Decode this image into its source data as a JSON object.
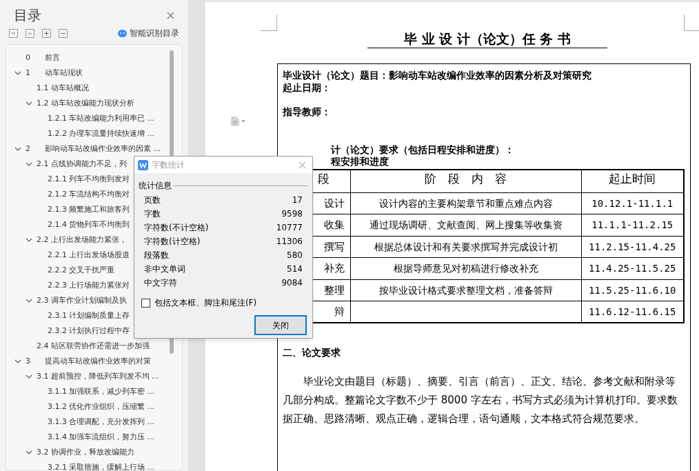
{
  "toc_panel": {
    "title": "目录",
    "smart_button": "智能识别目录",
    "items": [
      {
        "num": "0",
        "title": "前言"
      },
      {
        "num": "1",
        "title": "动车站现状",
        "expanded": true,
        "children": [
          {
            "num": "1.1",
            "title": "动车站概况"
          },
          {
            "num": "1.2",
            "title": "动车站改编能力现状分析",
            "expanded": true,
            "children": [
              {
                "num": "1.2.1",
                "title": "车站改编能力利用率已 ..."
              },
              {
                "num": "1.2.2",
                "title": "办理车流量持续快速增 ..."
              }
            ]
          }
        ]
      },
      {
        "num": "2",
        "title": "影响动车站改编作业效率的因素 ...",
        "expanded": true,
        "children": [
          {
            "num": "2.1",
            "title": "点线协调能力不足，列",
            "expanded": true,
            "children": [
              {
                "num": "2.1.1",
                "title": "列车不均衡到发对"
              },
              {
                "num": "2.1.2",
                "title": "车流结构不均衡对"
              },
              {
                "num": "2.1.3",
                "title": "频繁施工和旅客列"
              },
              {
                "num": "2.1.4",
                "title": "货物列车不均衡到"
              }
            ]
          },
          {
            "num": "2.2",
            "title": "上行出发场能力紧张，",
            "expanded": true,
            "children": [
              {
                "num": "2.2.1",
                "title": "上行出发场场股道"
              },
              {
                "num": "2.2.2",
                "title": "交叉干扰严重"
              },
              {
                "num": "2.2.3",
                "title": "上行场能力紧张对"
              }
            ]
          },
          {
            "num": "2.3",
            "title": "调车作业计划编制及执",
            "expanded": true,
            "children": [
              {
                "num": "2.3.1",
                "title": "计划编制质量上存"
              },
              {
                "num": "2.3.2",
                "title": "计划执行过程中存"
              }
            ]
          },
          {
            "num": "2.4",
            "title": "站区联劳协作还需进一步加强"
          }
        ]
      },
      {
        "num": "3",
        "title": "提高动车站改编作业效率的对策",
        "expanded": true,
        "children": [
          {
            "num": "3.1",
            "title": "超前预控，降低列车到发不均 ...",
            "expanded": true,
            "children": [
              {
                "num": "3.1.1",
                "title": "加强联系，减少列车密 ..."
              },
              {
                "num": "3.1.2",
                "title": "优化作业组织，压缩繁 ..."
              },
              {
                "num": "3.1.3",
                "title": "合理调配，充分发挥列 ..."
              },
              {
                "num": "3.1.4",
                "title": "加强车流组织，努力压 ..."
              }
            ]
          },
          {
            "num": "3.2",
            "title": "协调作业，释放改编能力",
            "expanded": true,
            "children": [
              {
                "num": "3.2.1",
                "title": "采取措施，缓解上行场 ..."
              }
            ]
          }
        ]
      }
    ]
  },
  "document": {
    "heading": "毕 业 设 计（论文）任 务 书",
    "lines": [
      "毕业设计（论文）题目：影响动车站改编作业效率的因素分析及对策研究",
      "起止日期：",
      "指导教师：",
      "计（论文）要求（包括日程安排和进度）：",
      "程安排和进度"
    ],
    "table": {
      "columns": [
        "段",
        "阶　段　内　容",
        "起止时间"
      ],
      "rows": [
        [
          "设计",
          "设计内容的主要构架章节和重点难点内容",
          "10.12.1-11.1.1"
        ],
        [
          "收集",
          "通过现场调研、文献查阅、网上搜集等收集资",
          "11.1.1-11.2.15"
        ],
        [
          "撰写",
          "根据总体设计和有关要求撰写并完成设计初",
          "11.2.15-11.4.25"
        ],
        [
          "补充",
          "根据导师意见对初稿进行修改补充",
          "11.4.25-11.5.25"
        ],
        [
          "整理",
          "按毕业设计格式要求整理文档，准备答辩",
          "11.5.25-11.6.10"
        ],
        [
          "辩",
          "",
          "11.6.12-11.6.15"
        ]
      ]
    },
    "section_heading": "二、论文要求",
    "paragraph": "毕业论文由题目（标题）、摘要、引言（前言）、正文、结论、参考文献和附录等几部分构成。整篇论文字数不少于 8000 字左右，书写方式必须为计算机打印。要求数据正确、思路清晰、观点正确，逻辑合理，语句通顺，文本格式符合规范要求。"
  },
  "dialog": {
    "title": "字数统计",
    "group": "统计信息",
    "stats": [
      {
        "label": "页数",
        "value": "17"
      },
      {
        "label": "字数",
        "value": "9598"
      },
      {
        "label": "字符数(不计空格)",
        "value": "10777"
      },
      {
        "label": "字符数(计空格)",
        "value": "11306"
      },
      {
        "label": "段落数",
        "value": "580"
      },
      {
        "label": "非中文单词",
        "value": "514"
      },
      {
        "label": "中文字符",
        "value": "9084"
      }
    ],
    "checkbox": {
      "label": "包括文本框、脚注和尾注(F)",
      "checked": false
    },
    "button": "关闭"
  }
}
